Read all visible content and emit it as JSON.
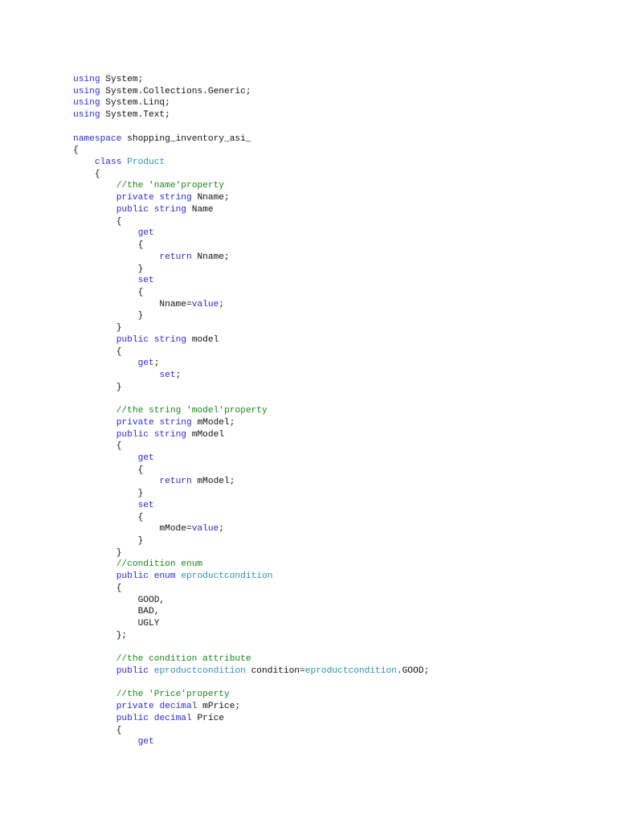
{
  "document": {
    "language": "C#",
    "colors": {
      "keyword": "#2a2ad6",
      "type": "#2b91af",
      "comment": "#188818",
      "text": "#111111",
      "background": "#ffffff"
    },
    "lines": [
      [
        {
          "k": "kw",
          "t": "using"
        },
        {
          "k": "tx",
          "t": " System;"
        }
      ],
      [
        {
          "k": "kw",
          "t": "using"
        },
        {
          "k": "tx",
          "t": " System.Collections.Generic;"
        }
      ],
      [
        {
          "k": "kw",
          "t": "using"
        },
        {
          "k": "tx",
          "t": " System.Linq;"
        }
      ],
      [
        {
          "k": "kw",
          "t": "using"
        },
        {
          "k": "tx",
          "t": " System.Text;"
        }
      ],
      [],
      [
        {
          "k": "kw",
          "t": "namespace"
        },
        {
          "k": "tx",
          "t": " shopping_inventory_asi_"
        }
      ],
      [
        {
          "k": "tx",
          "t": "{"
        }
      ],
      [
        {
          "k": "tx",
          "t": "    "
        },
        {
          "k": "kw",
          "t": "class"
        },
        {
          "k": "tx",
          "t": " "
        },
        {
          "k": "ty",
          "t": "Product"
        }
      ],
      [
        {
          "k": "tx",
          "t": "    {"
        }
      ],
      [
        {
          "k": "tx",
          "t": "        "
        },
        {
          "k": "cm",
          "t": "//the 'name'property"
        }
      ],
      [
        {
          "k": "tx",
          "t": "        "
        },
        {
          "k": "kw",
          "t": "private"
        },
        {
          "k": "tx",
          "t": " "
        },
        {
          "k": "kw",
          "t": "string"
        },
        {
          "k": "tx",
          "t": " Nname;"
        }
      ],
      [
        {
          "k": "tx",
          "t": "        "
        },
        {
          "k": "kw",
          "t": "public"
        },
        {
          "k": "tx",
          "t": " "
        },
        {
          "k": "kw",
          "t": "string"
        },
        {
          "k": "tx",
          "t": " Name"
        }
      ],
      [
        {
          "k": "tx",
          "t": "        {"
        }
      ],
      [
        {
          "k": "tx",
          "t": "            "
        },
        {
          "k": "kw",
          "t": "get"
        }
      ],
      [
        {
          "k": "tx",
          "t": "            {"
        }
      ],
      [
        {
          "k": "tx",
          "t": "                "
        },
        {
          "k": "kw",
          "t": "return"
        },
        {
          "k": "tx",
          "t": " Nname;"
        }
      ],
      [
        {
          "k": "tx",
          "t": "            }"
        }
      ],
      [
        {
          "k": "tx",
          "t": "            "
        },
        {
          "k": "kw",
          "t": "set"
        }
      ],
      [
        {
          "k": "tx",
          "t": "            {"
        }
      ],
      [
        {
          "k": "tx",
          "t": "                Nname="
        },
        {
          "k": "kw",
          "t": "value"
        },
        {
          "k": "tx",
          "t": ";"
        }
      ],
      [
        {
          "k": "tx",
          "t": "            }"
        }
      ],
      [
        {
          "k": "tx",
          "t": "        }"
        }
      ],
      [
        {
          "k": "tx",
          "t": "        "
        },
        {
          "k": "kw",
          "t": "public"
        },
        {
          "k": "tx",
          "t": " "
        },
        {
          "k": "kw",
          "t": "string"
        },
        {
          "k": "tx",
          "t": " model"
        }
      ],
      [
        {
          "k": "tx",
          "t": "        {"
        }
      ],
      [
        {
          "k": "tx",
          "t": "            "
        },
        {
          "k": "kw",
          "t": "get"
        },
        {
          "k": "tx",
          "t": ";"
        }
      ],
      [
        {
          "k": "tx",
          "t": "                "
        },
        {
          "k": "kw",
          "t": "set"
        },
        {
          "k": "tx",
          "t": ";"
        }
      ],
      [
        {
          "k": "tx",
          "t": "        }"
        }
      ],
      [],
      [
        {
          "k": "tx",
          "t": "        "
        },
        {
          "k": "cm",
          "t": "//the string 'model'property"
        }
      ],
      [
        {
          "k": "tx",
          "t": "        "
        },
        {
          "k": "kw",
          "t": "private"
        },
        {
          "k": "tx",
          "t": " "
        },
        {
          "k": "kw",
          "t": "string"
        },
        {
          "k": "tx",
          "t": " mModel;"
        }
      ],
      [
        {
          "k": "tx",
          "t": "        "
        },
        {
          "k": "kw",
          "t": "public"
        },
        {
          "k": "tx",
          "t": " "
        },
        {
          "k": "kw",
          "t": "string"
        },
        {
          "k": "tx",
          "t": " mModel"
        }
      ],
      [
        {
          "k": "tx",
          "t": "        {"
        }
      ],
      [
        {
          "k": "tx",
          "t": "            "
        },
        {
          "k": "kw",
          "t": "get"
        }
      ],
      [
        {
          "k": "tx",
          "t": "            {"
        }
      ],
      [
        {
          "k": "tx",
          "t": "                "
        },
        {
          "k": "kw",
          "t": "return"
        },
        {
          "k": "tx",
          "t": " mModel;"
        }
      ],
      [
        {
          "k": "tx",
          "t": "            }"
        }
      ],
      [
        {
          "k": "tx",
          "t": "            "
        },
        {
          "k": "kw",
          "t": "set"
        }
      ],
      [
        {
          "k": "tx",
          "t": "            {"
        }
      ],
      [
        {
          "k": "tx",
          "t": "                mMode="
        },
        {
          "k": "kw",
          "t": "value"
        },
        {
          "k": "tx",
          "t": ";"
        }
      ],
      [
        {
          "k": "tx",
          "t": "            }"
        }
      ],
      [
        {
          "k": "tx",
          "t": "        }"
        }
      ],
      [
        {
          "k": "tx",
          "t": "        "
        },
        {
          "k": "cm",
          "t": "//condition enum"
        }
      ],
      [
        {
          "k": "tx",
          "t": "        "
        },
        {
          "k": "kw",
          "t": "public"
        },
        {
          "k": "tx",
          "t": " "
        },
        {
          "k": "kw",
          "t": "enum"
        },
        {
          "k": "tx",
          "t": " "
        },
        {
          "k": "ty",
          "t": "eproductcondition"
        }
      ],
      [
        {
          "k": "tx",
          "t": "        {"
        }
      ],
      [
        {
          "k": "tx",
          "t": "            GOOD,"
        }
      ],
      [
        {
          "k": "tx",
          "t": "            BAD,"
        }
      ],
      [
        {
          "k": "tx",
          "t": "            UGLY"
        }
      ],
      [
        {
          "k": "tx",
          "t": "        };"
        }
      ],
      [],
      [
        {
          "k": "tx",
          "t": "        "
        },
        {
          "k": "cm",
          "t": "//the condition attribute"
        }
      ],
      [
        {
          "k": "tx",
          "t": "        "
        },
        {
          "k": "kw",
          "t": "public"
        },
        {
          "k": "tx",
          "t": " "
        },
        {
          "k": "ty",
          "t": "eproductcondition"
        },
        {
          "k": "tx",
          "t": " condition="
        },
        {
          "k": "ty",
          "t": "eproductcondition"
        },
        {
          "k": "tx",
          "t": ".GOOD;"
        }
      ],
      [],
      [
        {
          "k": "tx",
          "t": "        "
        },
        {
          "k": "cm",
          "t": "//the 'Price'property"
        }
      ],
      [
        {
          "k": "tx",
          "t": "        "
        },
        {
          "k": "kw",
          "t": "private"
        },
        {
          "k": "tx",
          "t": " "
        },
        {
          "k": "kw",
          "t": "decimal"
        },
        {
          "k": "tx",
          "t": " mPrice;"
        }
      ],
      [
        {
          "k": "tx",
          "t": "        "
        },
        {
          "k": "kw",
          "t": "public"
        },
        {
          "k": "tx",
          "t": " "
        },
        {
          "k": "kw",
          "t": "decimal"
        },
        {
          "k": "tx",
          "t": " Price"
        }
      ],
      [
        {
          "k": "tx",
          "t": "        {"
        }
      ],
      [
        {
          "k": "tx",
          "t": "            "
        },
        {
          "k": "kw",
          "t": "get"
        }
      ]
    ]
  }
}
